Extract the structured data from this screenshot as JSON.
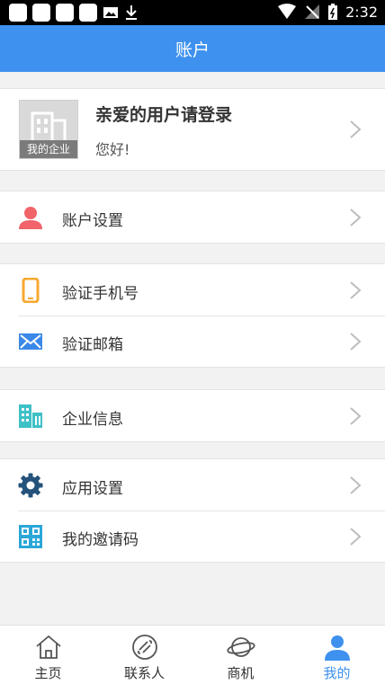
{
  "status_bar": {
    "time": "2:32"
  },
  "header": {
    "title": "账户"
  },
  "profile": {
    "title": "亲爱的用户请登录",
    "subtitle": "您好!",
    "avatar_caption": "我的企业"
  },
  "menu": {
    "account_settings": "账户设置",
    "verify_phone": "验证手机号",
    "verify_email": "验证邮箱",
    "company_info": "企业信息",
    "app_settings": "应用设置",
    "my_invite_code": "我的邀请码"
  },
  "tabs": [
    {
      "label": "主页",
      "icon": "home-icon"
    },
    {
      "label": "联系人",
      "icon": "link-icon"
    },
    {
      "label": "商机",
      "icon": "planet-icon"
    },
    {
      "label": "我的",
      "icon": "person-icon"
    }
  ],
  "colors": {
    "accent": "#3e91ee",
    "person_icon": "#f0646a",
    "phone_icon": "#f7a830",
    "email_icon": "#3a88e8",
    "company_icon": "#3ec0c7",
    "gear_icon": "#24527a",
    "qr_icon": "#2aa7d8"
  }
}
